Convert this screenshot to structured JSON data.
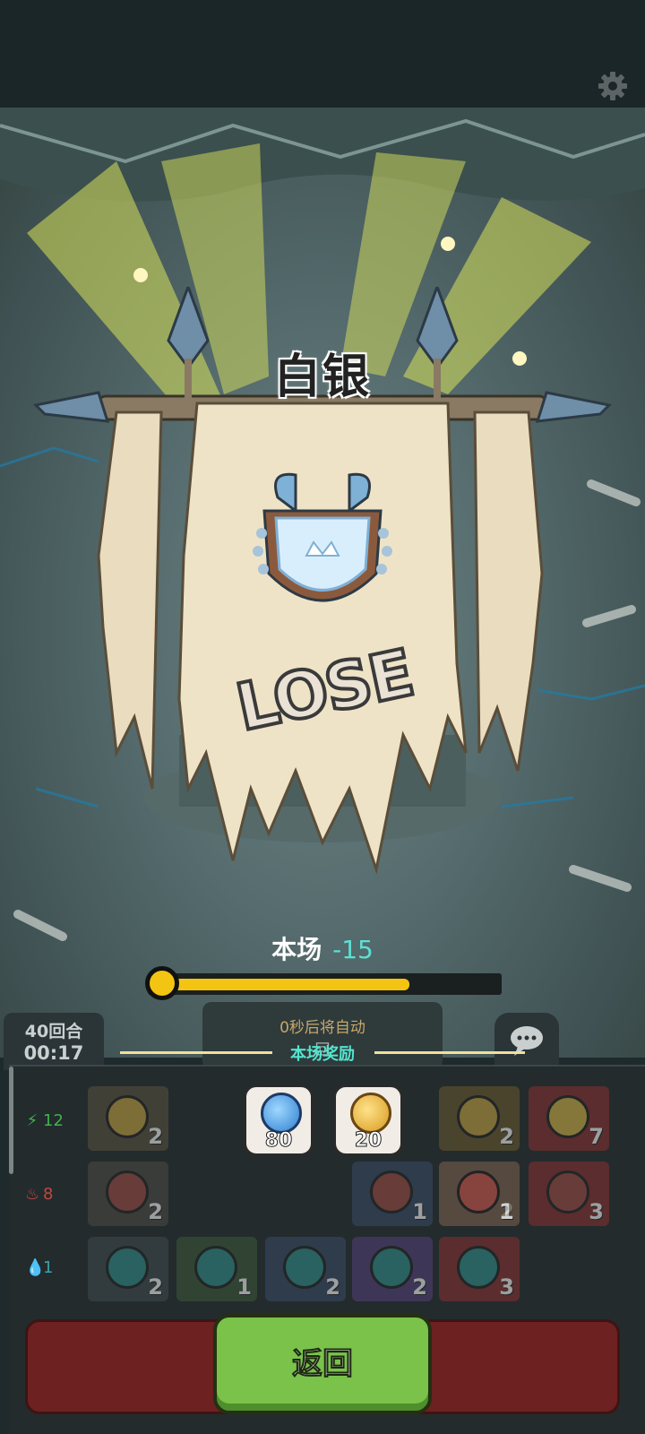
{
  "result": {
    "rank_name": "白银",
    "outcome_text": "LOSE",
    "score_label": "本场",
    "score_delta": "-15",
    "rank_progress": 0.84
  },
  "match": {
    "turns": "40回合",
    "clock": "00:17",
    "auto_notice_line1": "0秒后将自动",
    "auto_notice_line2": "回"
  },
  "rewards": {
    "title": "本场奖励",
    "items": [
      {
        "icon": "energy-orb-icon",
        "count": "80"
      },
      {
        "icon": "gold-coin-icon",
        "count": "20"
      }
    ]
  },
  "stats": [
    {
      "icon": "lightning-icon",
      "value": "12",
      "color": "#3fb34a"
    },
    {
      "icon": "fire-icon",
      "value": "8",
      "color": "#c0483f"
    },
    {
      "icon": "water-drop-icon",
      "value": "1",
      "color": "#3aa4a8"
    }
  ],
  "cards": [
    {
      "row": 0,
      "col": 0,
      "count": "2",
      "color": "#5a5240",
      "emblem": "#c8a340"
    },
    {
      "row": 0,
      "col": 5,
      "count": "2",
      "color": "#6a5a2e",
      "emblem": "#c8a340"
    },
    {
      "row": 0,
      "col": 6,
      "count": "7",
      "color": "#8a3030",
      "emblem": "#d6b646"
    },
    {
      "row": 1,
      "col": 0,
      "count": "2",
      "color": "#4e4a45",
      "emblem": "#a24b43"
    },
    {
      "row": 1,
      "col": 3,
      "count": "1",
      "color": "#394a66",
      "emblem": "#a24b43"
    },
    {
      "row": 1,
      "col": 4,
      "count": "2",
      "color": "#55407a",
      "emblem": "#a24b43"
    },
    {
      "row": 1,
      "col": 5,
      "count": "1",
      "color": "#6a5a2e",
      "emblem": "#a24b43"
    },
    {
      "row": 1,
      "col": 6,
      "count": "3",
      "color": "#8a3030",
      "emblem": "#a24b43"
    },
    {
      "row": 2,
      "col": 0,
      "count": "2",
      "color": "#3f4a4c",
      "emblem": "#2f8f8a"
    },
    {
      "row": 2,
      "col": 1,
      "count": "1",
      "color": "#3d5a3a",
      "emblem": "#2f8f8a"
    },
    {
      "row": 2,
      "col": 2,
      "count": "2",
      "color": "#394a66",
      "emblem": "#2f8f8a"
    },
    {
      "row": 2,
      "col": 3,
      "count": "2",
      "color": "#55407a",
      "emblem": "#2f8f8a"
    },
    {
      "row": 2,
      "col": 5,
      "count": "3",
      "color": "#8a3030",
      "emblem": "#2f8f8a"
    }
  ],
  "actions": {
    "back_label": "返回"
  },
  "colors": {
    "accent_teal": "#52e5cf",
    "progress_yellow": "#f4c412",
    "button_green": "#7ac24a"
  }
}
